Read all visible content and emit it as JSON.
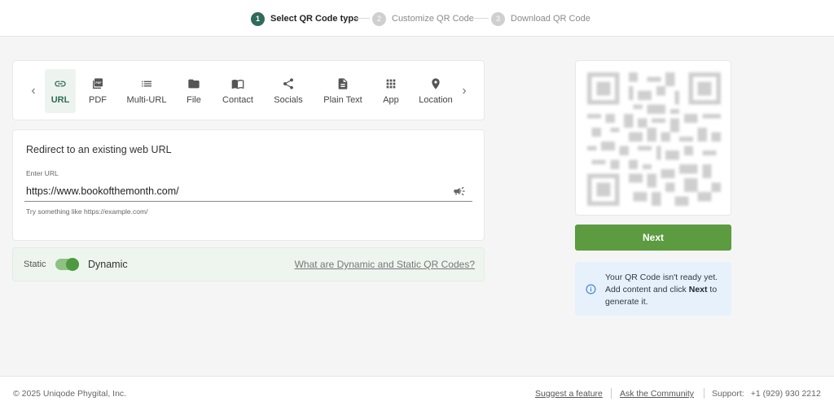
{
  "steps": [
    {
      "num": "1",
      "label": "Select QR Code type"
    },
    {
      "num": "2",
      "label": "Customize QR Code"
    },
    {
      "num": "3",
      "label": "Download QR Code"
    }
  ],
  "types": [
    {
      "label": "URL",
      "icon": "link-icon"
    },
    {
      "label": "PDF",
      "icon": "pdf-icon"
    },
    {
      "label": "Multi-URL",
      "icon": "list-icon"
    },
    {
      "label": "File",
      "icon": "folder-icon"
    },
    {
      "label": "Contact",
      "icon": "contact-book-icon"
    },
    {
      "label": "Socials",
      "icon": "share-icon"
    },
    {
      "label": "Plain Text",
      "icon": "document-icon"
    },
    {
      "label": "App",
      "icon": "app-grid-icon"
    },
    {
      "label": "Location",
      "icon": "location-pin-icon"
    }
  ],
  "url_card": {
    "heading": "Redirect to an existing web URL",
    "field_label": "Enter URL",
    "value": "https://www.bookofthemonth.com/",
    "hint": "Try something like https://example.com/"
  },
  "toggle": {
    "static_label": "Static",
    "dynamic_label": "Dynamic",
    "help_link": "What are Dynamic and Static QR Codes?"
  },
  "next_button": "Next",
  "info": {
    "line1": "Your QR Code isn't ready yet. Add content and click ",
    "bold": "Next",
    "line2": " to generate it."
  },
  "footer": {
    "copyright": "© 2025 Uniqode Phygital, Inc.",
    "suggest": "Suggest a feature",
    "community": "Ask the Community",
    "support_label": "Support:",
    "support_phone": "+1 (929) 930 2212"
  },
  "colors": {
    "accent": "#2f6b5a",
    "button": "#5c9b3f",
    "info_bg": "#e6f1fb"
  }
}
